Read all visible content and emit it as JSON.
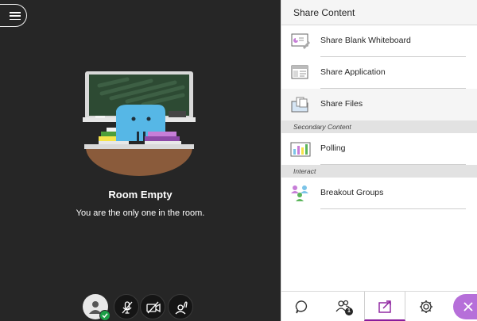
{
  "stage": {
    "menu_icon": "hamburger-menu-icon",
    "room_title": "Room Empty",
    "room_subtitle": "You are the only one in the room."
  },
  "controls": [
    {
      "name": "my-status-avatar",
      "icon": "user-avatar-icon",
      "status_color": "#1b9e46"
    },
    {
      "name": "microphone-toggle",
      "icon": "microphone-off-icon"
    },
    {
      "name": "camera-toggle",
      "icon": "camera-off-icon"
    },
    {
      "name": "raise-hand-toggle",
      "icon": "raise-hand-icon"
    }
  ],
  "panel": {
    "title": "Share Content",
    "items": [
      {
        "label": "Share Blank Whiteboard",
        "icon": "whiteboard-icon"
      },
      {
        "label": "Share Application",
        "icon": "application-window-icon"
      },
      {
        "label": "Share Files",
        "icon": "folder-files-icon"
      }
    ],
    "sections": [
      {
        "title": "Secondary Content",
        "items": [
          {
            "label": "Polling",
            "icon": "bar-chart-icon"
          }
        ]
      },
      {
        "title": "Interact",
        "items": [
          {
            "label": "Breakout Groups",
            "icon": "breakout-groups-icon"
          }
        ]
      }
    ]
  },
  "tabbar": {
    "tabs": [
      {
        "name": "chat",
        "icon": "chat-bubble-icon"
      },
      {
        "name": "attendees",
        "icon": "attendees-icon",
        "badge": "1"
      },
      {
        "name": "share-content",
        "icon": "share-content-icon",
        "active": true
      },
      {
        "name": "settings",
        "icon": "gear-icon"
      }
    ],
    "close_icon": "close-icon",
    "accent_color": "#8a1c9c"
  }
}
